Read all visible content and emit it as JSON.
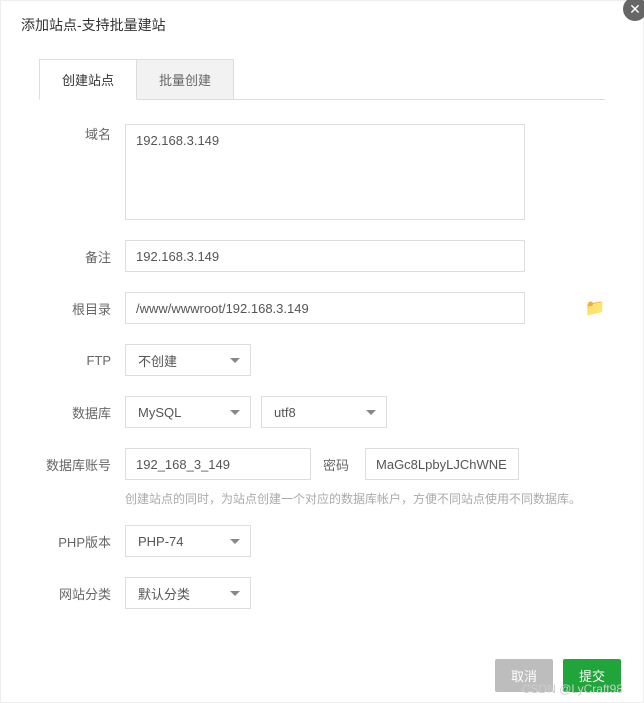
{
  "header": {
    "title": "添加站点-支持批量建站"
  },
  "tabs": [
    {
      "label": "创建站点",
      "active": true
    },
    {
      "label": "批量创建",
      "active": false
    }
  ],
  "labels": {
    "domain": "域名",
    "remark": "备注",
    "root": "根目录",
    "ftp": "FTP",
    "db": "数据库",
    "dbAccount": "数据库账号",
    "dbPwd": "密码",
    "php": "PHP版本",
    "category": "网站分类"
  },
  "values": {
    "domain": "192.168.3.149",
    "remark": "192.168.3.149",
    "root": "/www/wwwroot/192.168.3.149",
    "ftp": "不创建",
    "dbType": "MySQL",
    "dbCharset": "utf8",
    "dbAccount": "192_168_3_149",
    "dbPwd": "MaGc8LpbyLJChWNE",
    "php": "PHP-74",
    "category": "默认分类"
  },
  "hint": "创建站点的同时，为站点创建一个对应的数据库帐户，方便不同站点使用不同数据库。",
  "footer": {
    "cancel": "取消",
    "submit": "提交"
  },
  "watermark": "CSDN @LyCraft98"
}
